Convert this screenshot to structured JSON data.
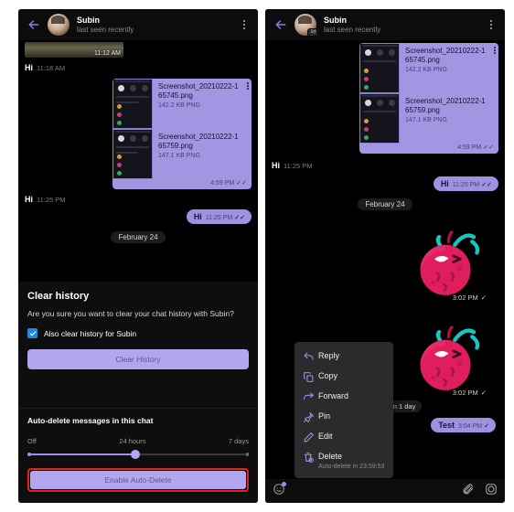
{
  "left_panel": {
    "header": {
      "back_icon": "back-arrow-icon",
      "avatar_icon": "contact-avatar",
      "name": "Subin",
      "status": "last seen recently",
      "menu_icon": "overflow-menu-icon"
    },
    "messages": [
      {
        "type": "photo",
        "timestamp": "11:12 AM"
      },
      {
        "type": "incoming_text",
        "text": "Hi",
        "timestamp": "11:18 AM"
      },
      {
        "type": "file_group",
        "timestamp": "4:59 PM",
        "ticks": "✓✓",
        "files": [
          {
            "name": "Screenshot_20210222-165745.png",
            "size": "142.2 KB PNG"
          },
          {
            "name": "Screenshot_20210222-165759.png",
            "size": "147.1 KB PNG"
          }
        ]
      },
      {
        "type": "incoming_text",
        "text": "Hi",
        "timestamp": "11:25 PM"
      },
      {
        "type": "outgoing_text",
        "text": "Hi",
        "timestamp": "11:25 PM",
        "ticks": "✓✓"
      },
      {
        "type": "day_divider",
        "text": "February 24"
      }
    ],
    "clear_history_sheet": {
      "title": "Clear history",
      "body": "Are you sure you want to clear your chat history with Subin?",
      "checkbox_label": "Also clear history for Subin",
      "checkbox_checked": true,
      "checkbox_color": "#1e88e5",
      "button_label": "Clear History",
      "button_color": "#b3a6f0"
    },
    "auto_delete_section": {
      "title": "Auto-delete messages in this chat",
      "slider_labels": [
        "Off",
        "24 hours",
        "7 days"
      ],
      "slider_value": "24 hours",
      "button_label": "Enable Auto-Delete",
      "button_color": "#b3a6f0",
      "highlight_color": "#e02222"
    }
  },
  "right_panel": {
    "header": {
      "back_icon": "back-arrow-icon",
      "avatar_icon": "contact-avatar",
      "avatar_badge": "1d",
      "name": "Subin",
      "status": "last seen recently",
      "menu_icon": "overflow-menu-icon"
    },
    "messages": [
      {
        "type": "file_group",
        "timestamp": "4:59 PM",
        "ticks": "✓✓",
        "files": [
          {
            "name": "Screenshot_20210222-165745.png",
            "size": "142.2 KB PNG"
          },
          {
            "name": "Screenshot_20210222-165759.png",
            "size": "147.1 KB PNG"
          }
        ]
      },
      {
        "type": "incoming_text",
        "text": "Hi",
        "timestamp": "11:25 PM"
      },
      {
        "type": "outgoing_text",
        "text": "Hi",
        "timestamp": "11:25 PM",
        "ticks": "✓✓"
      },
      {
        "type": "day_divider",
        "text": "February 24"
      },
      {
        "type": "sticker",
        "timestamp": "3:02 PM",
        "ticks": "✓"
      },
      {
        "type": "sticker",
        "timestamp": "3:02 PM",
        "ticks": "✓"
      },
      {
        "type": "service",
        "text": "Auto-delete in 1 day"
      },
      {
        "type": "outgoing_text",
        "text": "Test",
        "timestamp": "3:04 PM",
        "ticks": "✓"
      }
    ],
    "context_menu": {
      "items": [
        {
          "icon": "reply-icon",
          "label": "Reply"
        },
        {
          "icon": "copy-icon",
          "label": "Copy"
        },
        {
          "icon": "forward-icon",
          "label": "Forward"
        },
        {
          "icon": "pin-icon",
          "label": "Pin"
        },
        {
          "icon": "edit-icon",
          "label": "Edit"
        },
        {
          "icon": "delete-icon",
          "label": "Delete",
          "sublabel": "Auto-delete in 23:59:53"
        }
      ]
    },
    "composer": {
      "sticker_icon": "sticker-smiley-icon",
      "attach_icon": "paperclip-icon",
      "camera_icon": "camera-icon"
    }
  }
}
